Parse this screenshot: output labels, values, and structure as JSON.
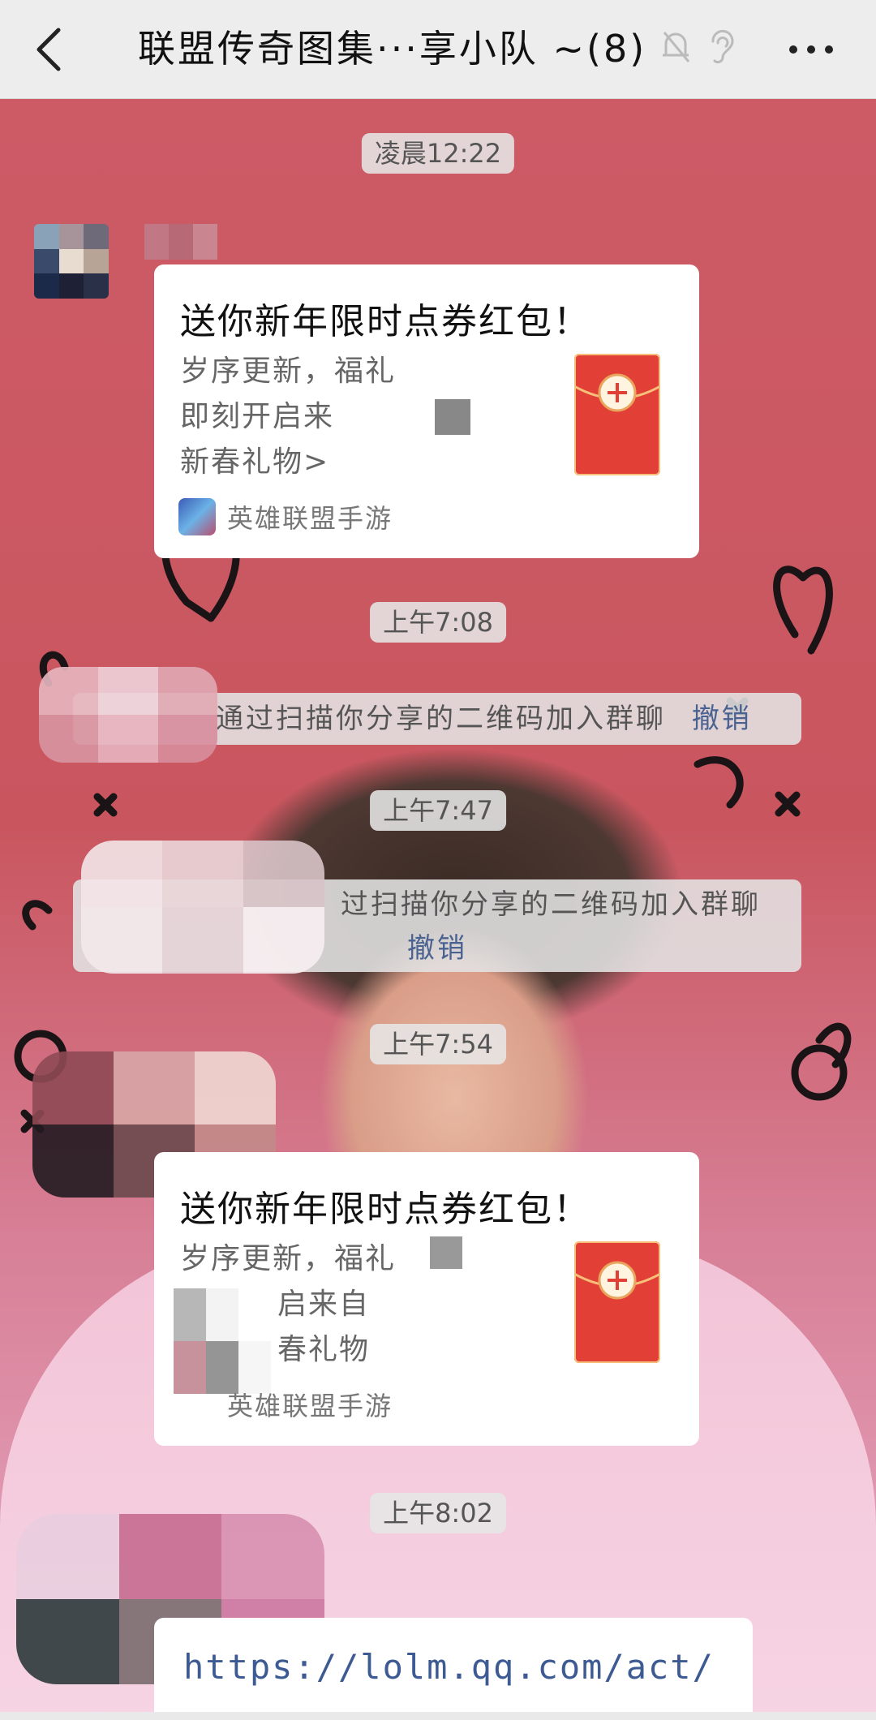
{
  "header": {
    "title": "联盟传奇图集···享小队 ~(8)",
    "icons": [
      "back-arrow-icon",
      "mute-bell-icon",
      "ear-icon",
      "more-icon"
    ]
  },
  "messages": {
    "ts1": "凌晨12:22",
    "ts2": "上午7:08",
    "ts3": "上午7:47",
    "ts4": "上午7:54",
    "ts5": "上午8:02",
    "card1": {
      "title": "送你新年限时点券红包！",
      "line1": "岁序更新，福礼",
      "line2": "即刻开启来",
      "line3": "新春礼物>",
      "source": "英雄联盟手游"
    },
    "sys1": {
      "text": "通过扫描你分享的二维码加入群聊",
      "revoke": "撤销"
    },
    "sys2": {
      "text": "过扫描你分享的二维码加入群聊",
      "revoke": "撤销"
    },
    "card2": {
      "title": "送你新年限时点券红包！",
      "line1": "岁序更新，福礼",
      "line2": "启来自",
      "line3": "春礼物",
      "source": "英雄联盟手游"
    },
    "link": {
      "url": "https://lolm.qq.com/act/"
    }
  },
  "colors": {
    "revoke": "#4a6291",
    "envelope": "#e23f36",
    "titlebar": "#ededed"
  }
}
